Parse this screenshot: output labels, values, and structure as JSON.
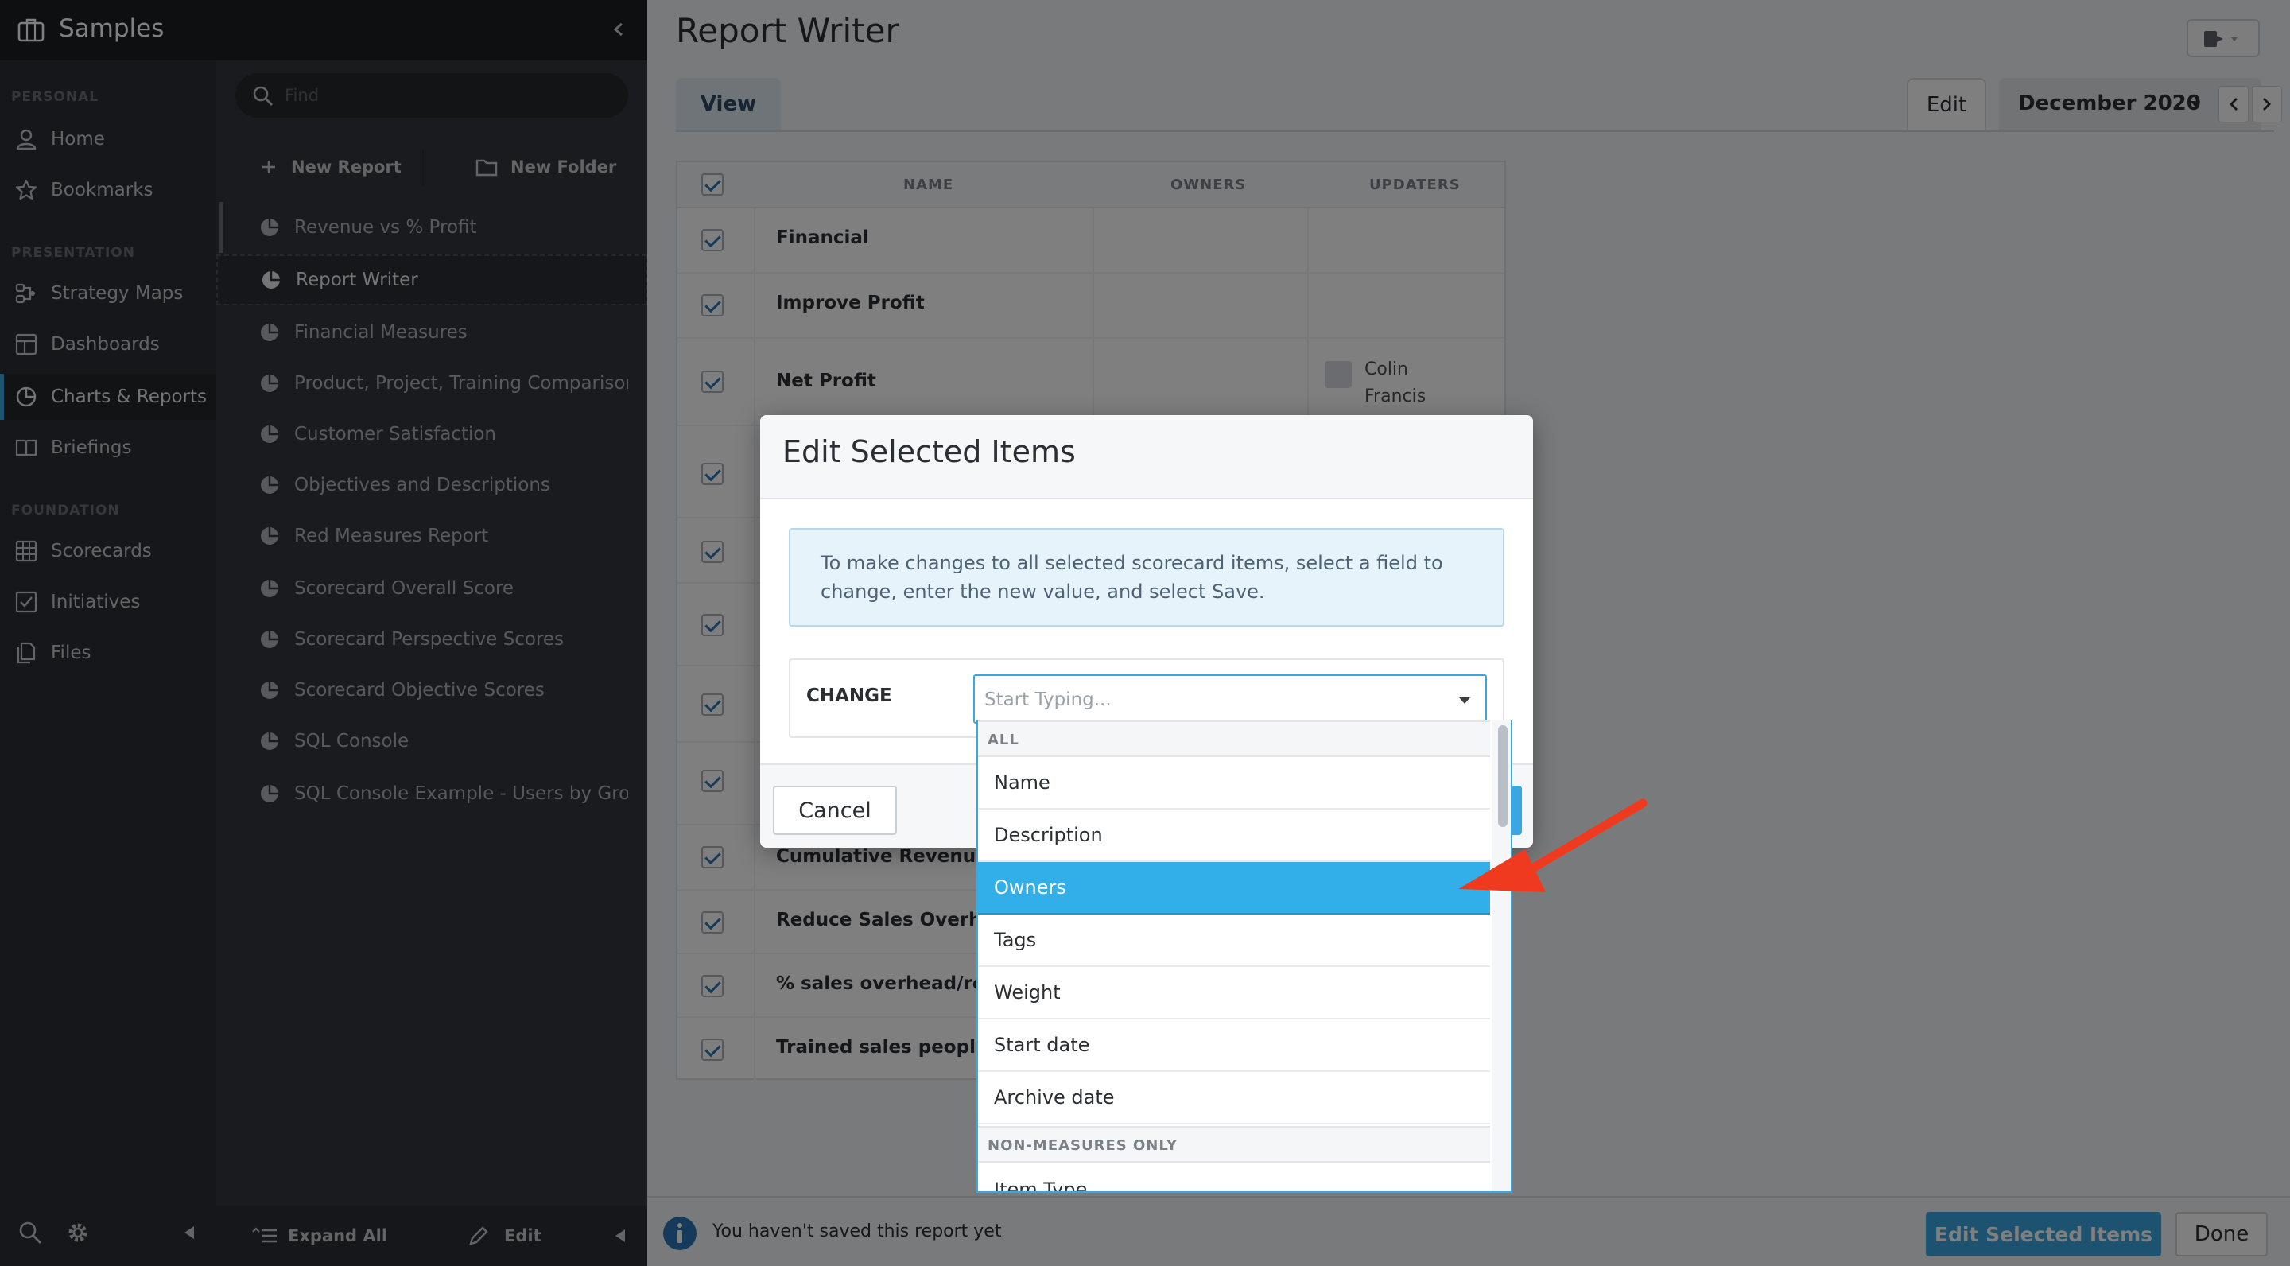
{
  "app": {
    "title": "Samples"
  },
  "nav": {
    "sections": {
      "personal": "PERSONAL",
      "presentation": "PRESENTATION",
      "foundation": "FOUNDATION"
    },
    "items": [
      {
        "label": "Home",
        "icon": "user-icon"
      },
      {
        "label": "Bookmarks",
        "icon": "star-icon"
      },
      {
        "label": "Strategy Maps",
        "icon": "strategy-map-icon"
      },
      {
        "label": "Dashboards",
        "icon": "dashboard-icon"
      },
      {
        "label": "Charts & Reports",
        "icon": "pie-chart-icon"
      },
      {
        "label": "Briefings",
        "icon": "book-icon"
      },
      {
        "label": "Scorecards",
        "icon": "grid-icon"
      },
      {
        "label": "Initiatives",
        "icon": "check-square-icon"
      },
      {
        "label": "Files",
        "icon": "files-icon"
      }
    ],
    "active_index": 4
  },
  "list": {
    "search_placeholder": "Find",
    "new_report": "New Report",
    "new_folder": "New Folder",
    "reports": [
      "Revenue vs % Profit",
      "Report Writer",
      "Financial Measures",
      "Product, Project, Training Comparison",
      "Customer Satisfaction",
      "Objectives and Descriptions",
      "Red Measures Report",
      "Scorecard Overall Score",
      "Scorecard Perspective Scores",
      "Scorecard Objective Scores",
      "SQL Console",
      "SQL Console Example - Users by Group"
    ],
    "selected_index": 1,
    "footer": {
      "expand_all": "Expand All",
      "edit": "Edit"
    }
  },
  "main": {
    "title": "Report Writer",
    "tabs": {
      "view": "View",
      "edit": "Edit"
    },
    "period": "December 2020",
    "table": {
      "headers": {
        "name": "NAME",
        "owners": "OWNERS",
        "updaters": "UPDATERS"
      },
      "rows": [
        {
          "name": "Financial"
        },
        {
          "name": "Improve Profit"
        },
        {
          "name": "Net Profit",
          "updater": "Colin Francis"
        },
        {
          "name": ""
        },
        {
          "name": ""
        },
        {
          "name": ""
        },
        {
          "name": ""
        },
        {
          "name": ""
        },
        {
          "name": "Cumulative Revenue"
        },
        {
          "name": "Reduce Sales Overhead"
        },
        {
          "name": "% sales overhead/revenue"
        },
        {
          "name": "Trained sales people"
        }
      ]
    },
    "footer": {
      "message": "You haven't saved this report yet",
      "edit_selected": "Edit Selected Items",
      "done": "Done"
    }
  },
  "modal": {
    "title": "Edit Selected Items",
    "info": "To make changes to all selected scorecard items, select a field to change, enter the new value, and select Save.",
    "change_label": "CHANGE",
    "select_placeholder": "Start Typing...",
    "cancel": "Cancel"
  },
  "dropdown": {
    "group_all": "ALL",
    "options": [
      "Name",
      "Description",
      "Owners",
      "Tags",
      "Weight",
      "Start date",
      "Archive date"
    ],
    "highlighted_index": 2,
    "group_non_measures": "NON-MEASURES ONLY",
    "partial_option": "Item Type"
  },
  "colors": {
    "accent": "#32aee8",
    "nav_bg": "#2b2f34",
    "annotation_arrow": "#f03a1f"
  }
}
